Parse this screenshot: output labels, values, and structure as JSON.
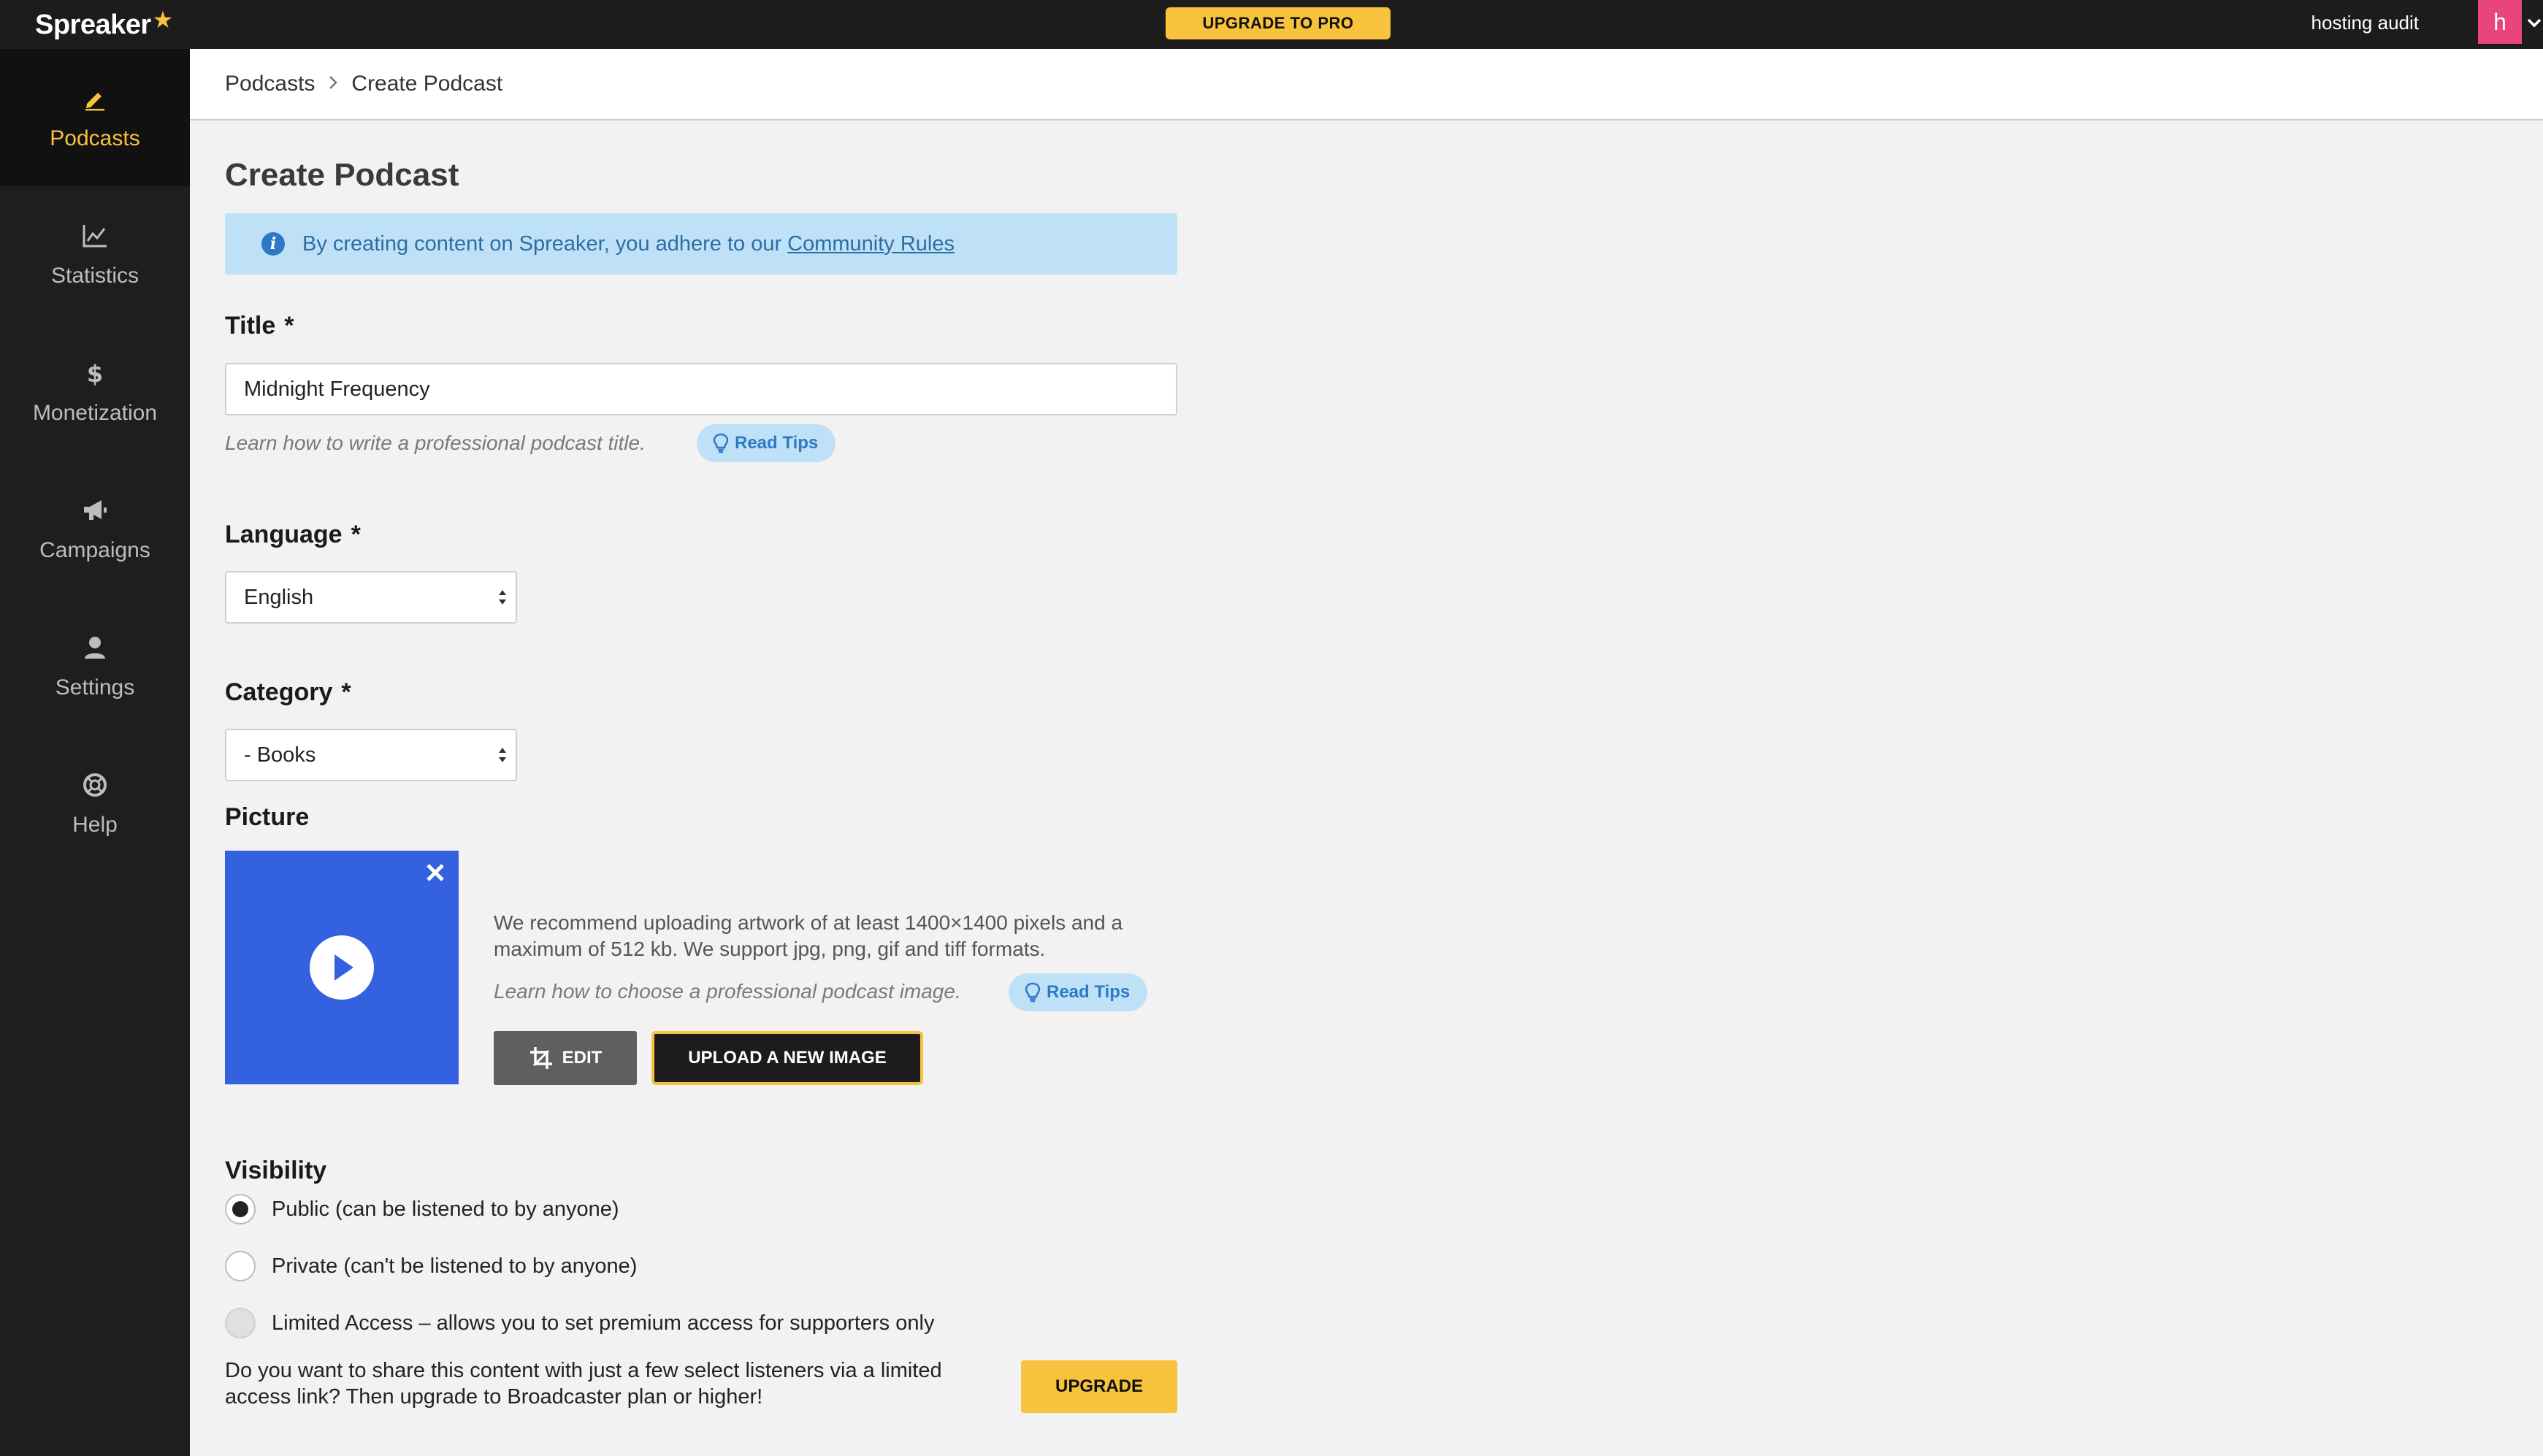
{
  "header": {
    "logo": "Spreaker",
    "logo_star": "★",
    "upgrade_label": "UPGRADE TO PRO",
    "account_name": "hosting audit",
    "avatar_letter": "h"
  },
  "sidebar": {
    "items": [
      {
        "label": "Podcasts",
        "icon": "pencil-icon",
        "active": true
      },
      {
        "label": "Statistics",
        "icon": "chart-icon",
        "active": false
      },
      {
        "label": "Monetization",
        "icon": "dollar-icon",
        "active": false
      },
      {
        "label": "Campaigns",
        "icon": "megaphone-icon",
        "active": false
      },
      {
        "label": "Settings",
        "icon": "user-icon",
        "active": false
      },
      {
        "label": "Help",
        "icon": "lifebuoy-icon",
        "active": false
      }
    ],
    "active_color": "#f7c23c"
  },
  "breadcrumb": {
    "root": "Podcasts",
    "current": "Create Podcast"
  },
  "page": {
    "title": "Create Podcast",
    "banner_text": "By creating content on Spreaker, you adhere to our",
    "banner_link": "Community Rules"
  },
  "form": {
    "title_label": "Title",
    "required_mark": "*",
    "title_value": "Midnight Frequency",
    "title_hint": "Learn how to write a professional podcast title.",
    "tips_label": "Read Tips",
    "language_label": "Language",
    "language_value": "English",
    "category_label": "Category",
    "category_value": "- Books",
    "picture_label": "Picture",
    "picture_desc": "We recommend uploading artwork of at least 1400×1400 pixels and a maximum of 512 kb. We support jpg, png, gif and tiff formats.",
    "picture_hint": "Learn how to choose a professional podcast image.",
    "edit_label": "EDIT",
    "upload_label": "UPLOAD A NEW IMAGE",
    "visibility_label": "Visibility",
    "visibility_options": [
      {
        "label": "Public (can be listened to by anyone)",
        "state": "checked"
      },
      {
        "label": "Private (can't be listened to by anyone)",
        "state": "unchecked"
      },
      {
        "label": "Limited Access – allows you to set premium access for supporters only",
        "state": "disabled"
      }
    ],
    "upsell_text": "Do you want to share this content with just a few select listeners via a limited access link? Then upgrade to Broadcaster plan or higher!",
    "upgrade_label": "UPGRADE"
  },
  "colors": {
    "accent": "#f7c23c",
    "artwork": "#3461e0",
    "info_banner": "#bfe1f7",
    "avatar": "#e8457a"
  }
}
